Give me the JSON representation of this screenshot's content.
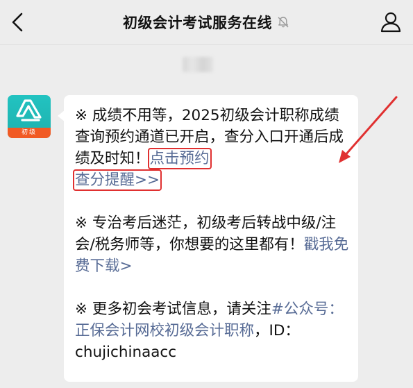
{
  "header": {
    "title": "初级会计考试服务在线",
    "back_icon": "chevron-left-icon",
    "mute_icon": "bell-muted-icon",
    "profile_icon": "person-icon"
  },
  "avatar": {
    "label": "初级",
    "accent": "#1fb6b3",
    "band_color": "#f15a24"
  },
  "message": {
    "p1": {
      "text": "※ 成绩不用等，2025初级会计职称成绩查询预约通道已开启，查分入口开通后成绩及时知！",
      "link_part1": "点击预约",
      "link_part2": "查分提醒>>"
    },
    "p2": {
      "text": "※ 专治考后迷茫，初级考后转战中级/注会/税务师等，你想要的这里都有！",
      "link": "戳我免费下载>"
    },
    "p3": {
      "text_before": "※ 更多初会考试信息，请关注",
      "link": "#公众号：正保会计网校初级会计职称",
      "text_after": "，ID：chujichinaacc"
    }
  },
  "colors": {
    "link": "#576b95",
    "highlight": "#e03030",
    "background": "#ededed"
  }
}
